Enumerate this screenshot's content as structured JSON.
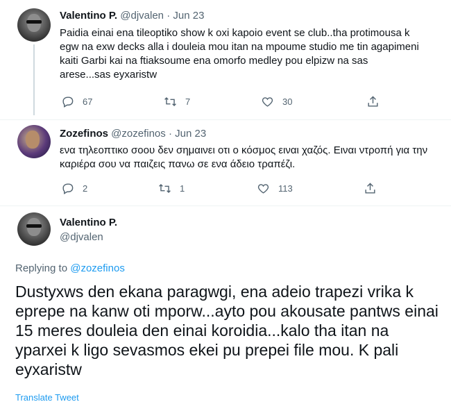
{
  "tweets": [
    {
      "name": "Valentino P.",
      "handle": "@djvalen",
      "sep": "·",
      "date": "Jun 23",
      "text": "Paidia einai ena tileoptiko show k oxi kapoio event se club..tha protimousa k egw na exw decks alla i douleia mou itan na mpoume studio me tin agapimeni kaiti Garbi kai na ftiaksoume ena omorfo medley pou elpizw na sas arese...sas eyxaristw",
      "replies": "67",
      "retweets": "7",
      "likes": "30"
    },
    {
      "name": "Zozefinos",
      "handle": "@zozefinos",
      "sep": "·",
      "date": "Jun 23",
      "text": "ενα τηλεοπτικο σοου δεν σημαινει οτι ο κόσμος ειναι χαζός. Ειναι ντροπή για την καριέρα σου να παιζεις πανω σε ενα άδειο τραπέζι.",
      "replies": "2",
      "retweets": "1",
      "likes": "113"
    }
  ],
  "main_tweet": {
    "name": "Valentino P.",
    "handle": "@djvalen",
    "replying_prefix": "Replying to",
    "replying_to": "@zozefinos",
    "text": "Dustyxws den ekana paragwgi, ena adeio trapezi vrika k eprepe na kanw oti mporw...ayto pou akousate pantws einai 15 meres douleia den einai koroidia...kalo tha itan na yparxei k ligo sevasmos ekei pu prepei file mou. K pali eyxaristw",
    "translate": "Translate Tweet"
  },
  "colors": {
    "link": "#1d9bf0",
    "secondary": "#536471",
    "line": "#cfd9de"
  }
}
